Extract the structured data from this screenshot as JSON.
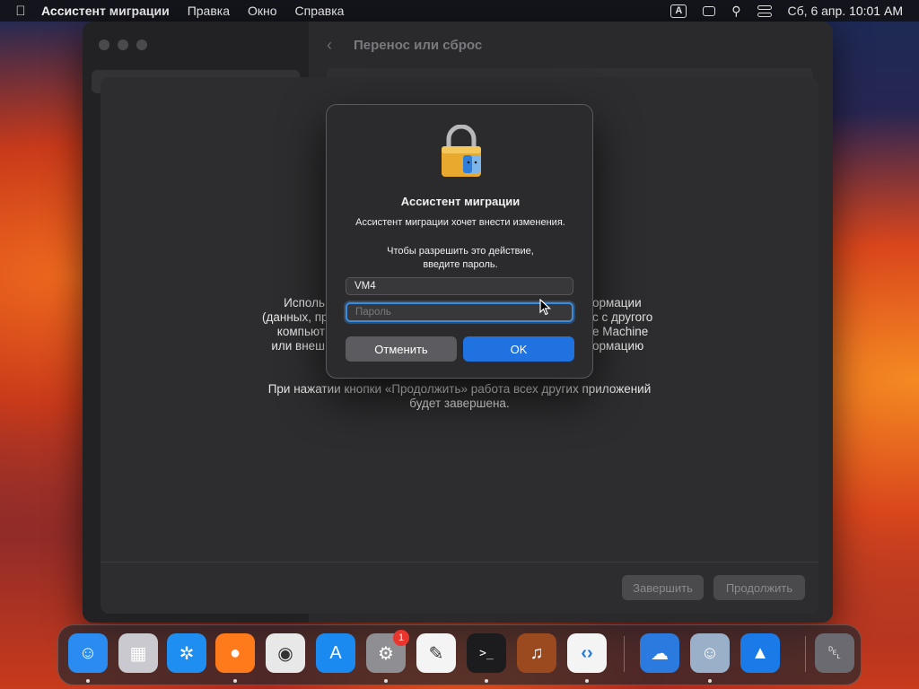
{
  "menubar": {
    "apple_icon": "apple-logo-icon",
    "app_name": "Ассистент миграции",
    "menus": [
      "Правка",
      "Окно",
      "Справка"
    ],
    "keyboard_label": "A",
    "datetime": "Сб, 6 апр.  10:01 AM"
  },
  "window": {
    "title": "Перенос или сброс"
  },
  "sheet": {
    "frag_left": [
      "Исполь",
      "(данных, пр",
      "компьют",
      "или внеш"
    ],
    "frag_right": [
      "ормации",
      "с с другого",
      "e Machine",
      "ормацию"
    ],
    "notice_line1": "При нажатии кнопки «Продолжить» работа всех других приложений",
    "notice_line2": "будет завершена.",
    "finish_button": "Завершить",
    "continue_button": "Продолжить"
  },
  "dialog": {
    "title": "Ассистент миграции",
    "message": "Ассистент миграции хочет внести изменения.",
    "prompt_line1": "Чтобы разрешить это действие,",
    "prompt_line2": "введите пароль.",
    "username_value": "VM4",
    "password_placeholder": "Пароль",
    "cancel_button": "Отменить",
    "ok_button": "OK"
  },
  "dock": {
    "apps": [
      {
        "name": "Finder",
        "icon": "finder-icon",
        "color": "#2a8cf0",
        "running": true
      },
      {
        "name": "Launchpad",
        "icon": "launchpad-icon",
        "color": "#c9c9cf",
        "running": false
      },
      {
        "name": "Safari",
        "icon": "safari-icon",
        "color": "#1e8ef0",
        "running": false
      },
      {
        "name": "Firefox",
        "icon": "firefox-icon",
        "color": "#ff7a1a",
        "running": true
      },
      {
        "name": "Chrome",
        "icon": "chrome-icon",
        "color": "#e8e8e8",
        "running": false
      },
      {
        "name": "App Store",
        "icon": "app-store-icon",
        "color": "#1a8af0",
        "running": false
      },
      {
        "name": "System Settings",
        "icon": "gear-icon",
        "color": "#8e8e93",
        "running": true,
        "badge": "1"
      },
      {
        "name": "TextEdit",
        "icon": "textedit-icon",
        "color": "#f4f4f4",
        "running": false
      },
      {
        "name": "Terminal",
        "icon": "terminal-icon",
        "color": "#1c1c1e",
        "running": true
      },
      {
        "name": "GarageBand",
        "icon": "guitar-icon",
        "color": "#9a4a1e",
        "running": false
      },
      {
        "name": "VS Code",
        "icon": "vscode-icon",
        "color": "#f4f4f4",
        "running": true
      },
      {
        "name": "Weather",
        "icon": "weather-icon",
        "color": "#2a7ae0",
        "running": false
      },
      {
        "name": "Migration Assistant",
        "icon": "migration-assistant-icon",
        "color": "#9ab0c8",
        "running": true
      },
      {
        "name": "Keynote",
        "icon": "keynote-icon",
        "color": "#1a7ae8",
        "running": false
      },
      {
        "name": "Trash",
        "icon": "trash-icon",
        "color": "#6a6a70",
        "running": false
      }
    ]
  }
}
